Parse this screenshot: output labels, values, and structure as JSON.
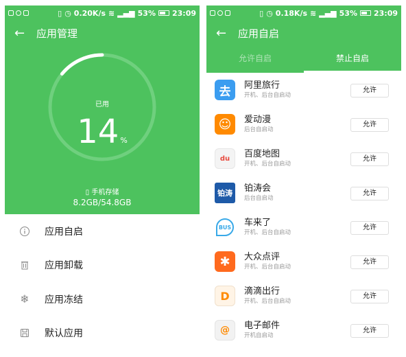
{
  "status_bar": {
    "left": {
      "speed": "0.20K/s",
      "battery_pct": "53%",
      "time": "23:09"
    },
    "right": {
      "speed": "0.18K/s",
      "battery_pct": "53%",
      "time": "23:09"
    }
  },
  "left_screen": {
    "title": "应用管理",
    "usage_label": "已用",
    "usage_percent": "14",
    "usage_unit": "%",
    "usage_fraction": 0.14,
    "storage_label": "手机存储",
    "storage_value": "8.2GB/54.8GB",
    "menu": [
      {
        "label": "应用自启",
        "icon": "info-icon"
      },
      {
        "label": "应用卸载",
        "icon": "trash-icon"
      },
      {
        "label": "应用冻结",
        "icon": "snowflake-icon"
      },
      {
        "label": "默认应用",
        "icon": "save-icon"
      }
    ]
  },
  "right_screen": {
    "title": "应用自启",
    "tabs": [
      {
        "label": "允许自启",
        "active": false
      },
      {
        "label": "禁止自启",
        "active": true
      }
    ],
    "apps": [
      {
        "name": "阿里旅行",
        "desc": "开机、后台自启动",
        "button": "允许",
        "icon_text": "去",
        "color": "#3b9df0"
      },
      {
        "name": "爱动漫",
        "desc": "后台自启动",
        "button": "允许",
        "icon_text": "☺",
        "color": "#ff8a00"
      },
      {
        "name": "百度地图",
        "desc": "开机、后台自启动",
        "button": "允许",
        "icon_text": "du",
        "color": "#e84a3e"
      },
      {
        "name": "铂涛会",
        "desc": "后台自启动",
        "button": "允许",
        "icon_text": "铂涛",
        "color": "#1e5aa8"
      },
      {
        "name": "车来了",
        "desc": "开机、后台自启动",
        "button": "允许",
        "icon_text": "BUS",
        "color": "#38a9e8"
      },
      {
        "name": "大众点评",
        "desc": "开机、后台自启动",
        "button": "允许",
        "icon_text": "✱",
        "color": "#ff6a1e"
      },
      {
        "name": "滴滴出行",
        "desc": "开机、后台自启动",
        "button": "允许",
        "icon_text": "D",
        "color": "#fff4e6"
      },
      {
        "name": "电子邮件",
        "desc": "开机自启动",
        "button": "允许",
        "icon_text": "@",
        "color": "#f2f2f2"
      }
    ]
  },
  "colors": {
    "accent": "#4dc25e",
    "ring_track": "#6fd07e",
    "ring_fill": "#ffffff"
  }
}
